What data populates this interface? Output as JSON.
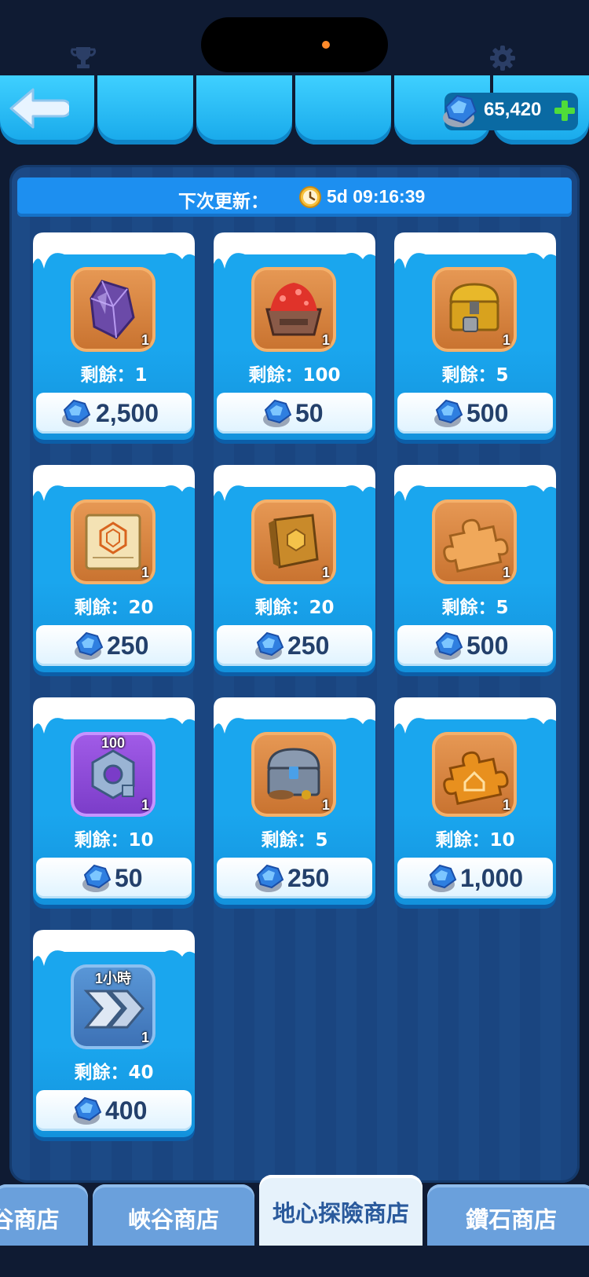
{
  "header": {
    "currency_amount": "65,420",
    "icons": [
      "trophy-icon",
      "gear-icon",
      "back-arrow-icon",
      "ore-gem-icon",
      "plus-icon"
    ]
  },
  "refresh": {
    "label": "下次更新：",
    "timer": "5d 09:16:39"
  },
  "items": [
    {
      "name": "purple-crystal",
      "qty": "1",
      "remaining": "剩餘：1",
      "price": "2,500",
      "frame": "orange"
    },
    {
      "name": "red-ore-cart",
      "qty": "1",
      "remaining": "剩餘：100",
      "price": "50",
      "frame": "orange"
    },
    {
      "name": "gold-chest",
      "qty": "1",
      "remaining": "剩餘：5",
      "price": "500",
      "frame": "orange"
    },
    {
      "name": "blueprint-scroll",
      "qty": "1",
      "remaining": "剩餘：20",
      "price": "250",
      "frame": "orange"
    },
    {
      "name": "gold-book",
      "qty": "1",
      "remaining": "剩餘：20",
      "price": "250",
      "frame": "orange"
    },
    {
      "name": "puzzle-piece",
      "qty": "1",
      "remaining": "剩餘：5",
      "price": "500",
      "frame": "orange"
    },
    {
      "name": "hex-nut",
      "qty": "1",
      "badge": "100",
      "remaining": "剩餘：10",
      "price": "50",
      "frame": "purple"
    },
    {
      "name": "silver-chest",
      "qty": "1",
      "remaining": "剩餘：5",
      "price": "250",
      "frame": "orange"
    },
    {
      "name": "house-puzzle-piece",
      "qty": "1",
      "remaining": "剩餘：10",
      "price": "1,000",
      "frame": "orange"
    },
    {
      "name": "speedup-1h",
      "qty": "1",
      "badge": "1小時",
      "remaining": "剩餘：40",
      "price": "400",
      "frame": "blue"
    }
  ],
  "bottom_tabs": [
    {
      "label": "谷商店",
      "active": false
    },
    {
      "label": "峽谷商店",
      "active": false
    },
    {
      "label": "地心探險商店",
      "active": true
    },
    {
      "label": "鑽石商店",
      "active": false
    }
  ],
  "colors": {
    "background": "#0f1b33",
    "panel": "#1c4a86",
    "card": "#1aa6ee",
    "banner": "#1d8ff0",
    "price_text": "#23406b",
    "active_tab": "#e6f2fb",
    "inactive_tab": "#6aa0dc"
  }
}
